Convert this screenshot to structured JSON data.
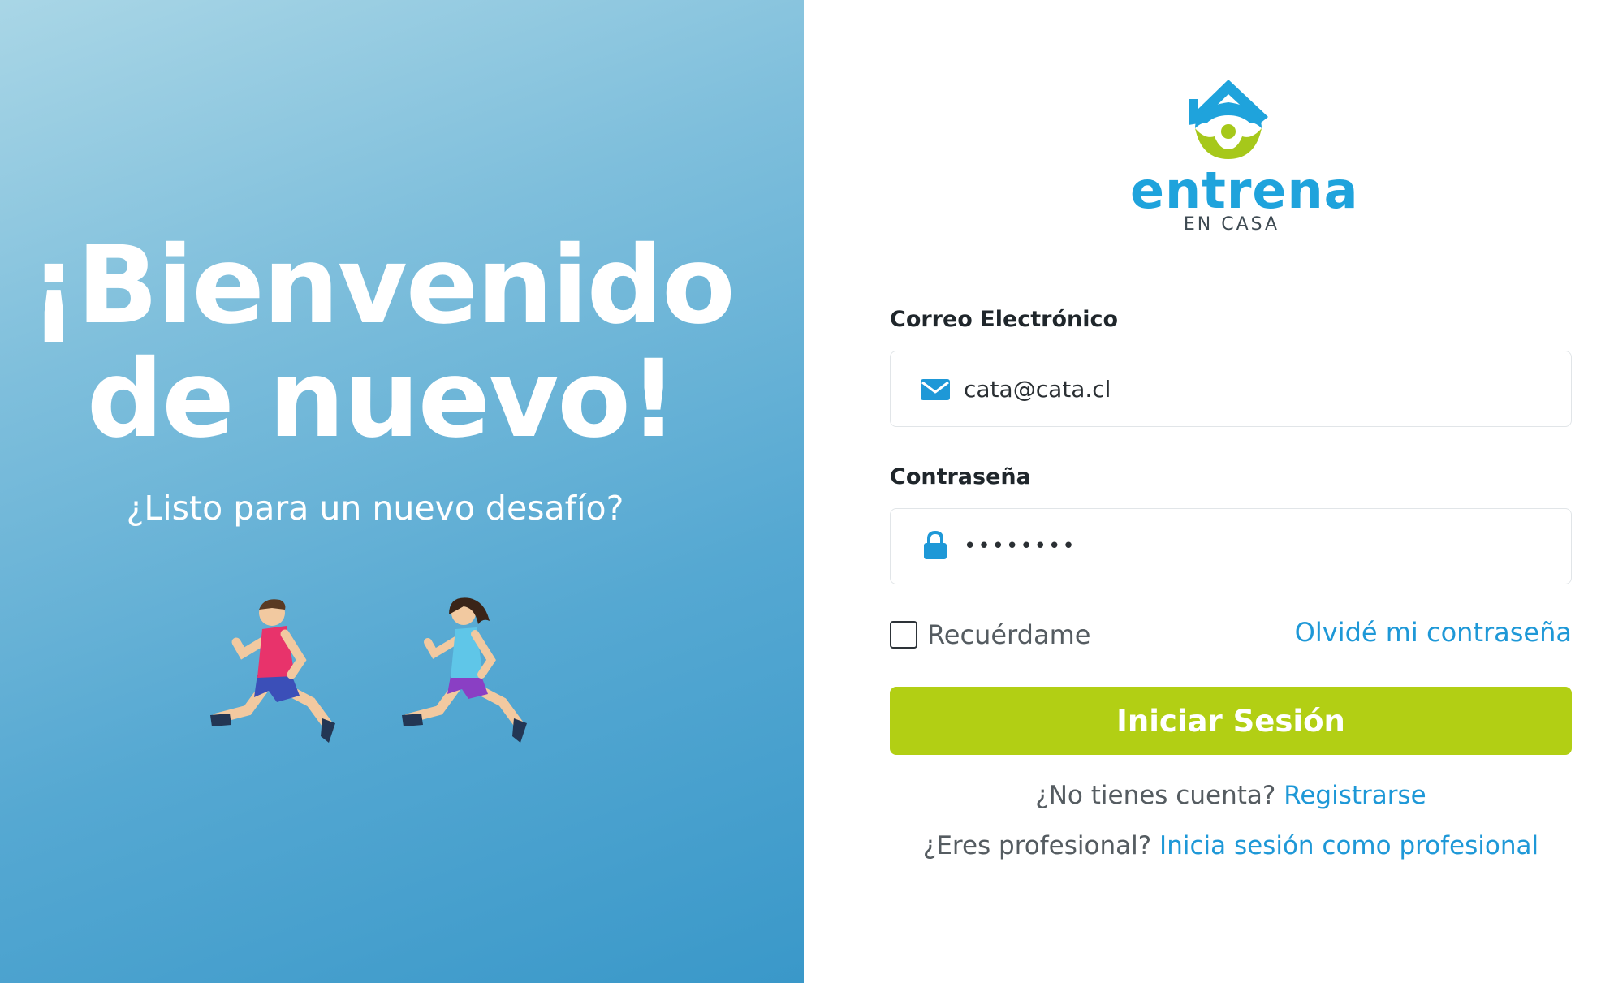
{
  "hero": {
    "title_line1": "¡Bienvenido",
    "title_line2": "de nuevo!",
    "subtitle": "¿Listo para un nuevo desafío?"
  },
  "logo": {
    "word": "entrena",
    "sub": "EN CASA"
  },
  "form": {
    "email_label": "Correo Electrónico",
    "email_value": "cata@cata.cl",
    "password_label": "Contraseña",
    "password_value": "••••••••",
    "remember_label": "Recuérdame",
    "remember_checked": false,
    "forgot_link": "Olvidé mi contraseña",
    "submit_label": "Iniciar Sesión"
  },
  "footer": {
    "signup_prompt": "¿No tienes cuenta?",
    "signup_link": "Registrarse",
    "pro_prompt": "¿Eres profesional?",
    "pro_link": "Inicia sesión como profesional"
  },
  "colors": {
    "accent_blue": "#1e98d7",
    "button_green": "#b2cf14",
    "logo_blue": "#1fa3dc",
    "logo_green": "#a6c81a"
  }
}
